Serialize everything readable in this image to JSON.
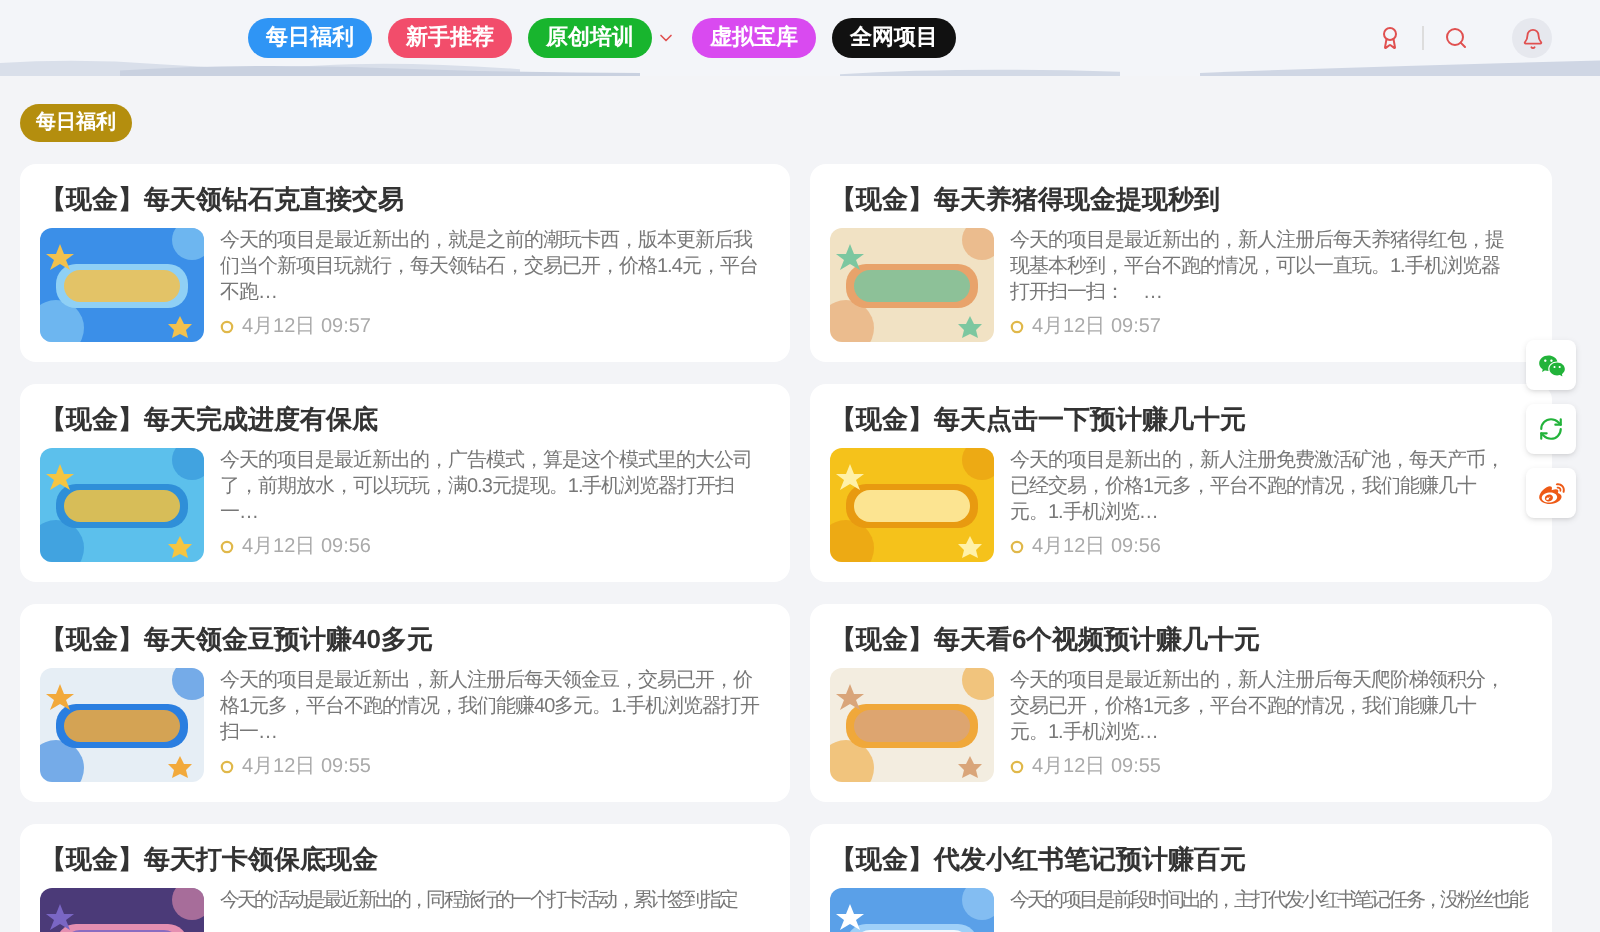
{
  "nav": [
    {
      "label": "每日福利",
      "color": "#2f95f5",
      "has_menu": false
    },
    {
      "label": "新手推荐",
      "color": "#f24d6b",
      "has_menu": false
    },
    {
      "label": "原创培训",
      "color": "#18b52e",
      "has_menu": true
    },
    {
      "label": "虚拟宝库",
      "color": "#d94af0",
      "has_menu": false
    },
    {
      "label": "全网项目",
      "color": "#111111",
      "has_menu": false
    }
  ],
  "section_tag": "每日福利",
  "cards": [
    {
      "title": "【现金】每天领钻石克直接交易",
      "description": "今天的项目是最近新出的，就是之前的潮玩卡西，版本更新后我们当个新项目玩就行，每天领钻石，交易已开，价格1.4元，平台不跑…",
      "date": "4月12日 09:57"
    },
    {
      "title": "【现金】每天养猪得现金提现秒到",
      "description": "今天的项目是最近新出的，新人注册后每天养猪得红包，提现基本秒到，平台不跑的情况，可以一直玩。1.手机浏览器打开扫一扫：　…",
      "date": "4月12日 09:57"
    },
    {
      "title": "【现金】每天完成进度有保底",
      "description": "今天的项目是最近新出的，广告模式，算是这个模式里的大公司了，前期放水，可以玩玩，满0.3元提现。1.手机浏览器打开扫一…",
      "date": "4月12日 09:56"
    },
    {
      "title": "【现金】每天点击一下预计赚几十元",
      "description": "今天的项目是新出的，新人注册免费激活矿池，每天产币，已经交易，价格1元多，平台不跑的情况，我们能赚几十元。1.手机浏览…",
      "date": "4月12日 09:56"
    },
    {
      "title": "【现金】每天领金豆预计赚40多元",
      "description": "今天的项目是最近新出，新人注册后每天领金豆，交易已开，价格1元多，平台不跑的情况，我们能赚40多元。1.手机浏览器打开扫一…",
      "date": "4月12日 09:55"
    },
    {
      "title": "【现金】每天看6个视频预计赚几十元",
      "description": "今天的项目是最近新出的，新人注册后每天爬阶梯领积分，交易已开，价格1元多，平台不跑的情况，我们能赚几十元。1.手机浏览…",
      "date": "4月12日 09:55"
    },
    {
      "title": "【现金】每天打卡领保底现金",
      "description": "今天的活动是最近新出的，同程旅行的一个打卡活动，累计签到指定"
    },
    {
      "title": "【现金】代发小红书笔记预计赚百元",
      "description": "今天的项目是前段时间出的，主打代发小红书笔记任务，没粉丝也能"
    }
  ]
}
